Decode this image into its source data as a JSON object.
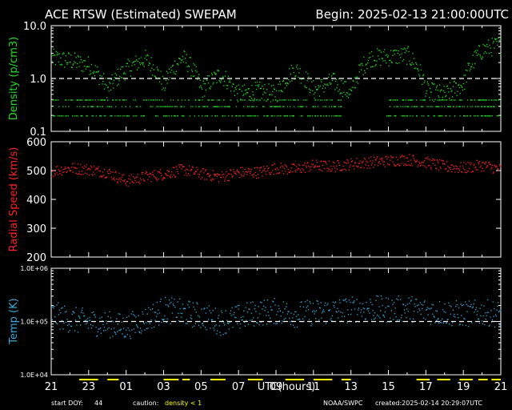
{
  "header": {
    "title": "ACE RTSW (Estimated) SWEPAM",
    "begin": "Begin: 2025-02-13 21:00:00UTC"
  },
  "footer": {
    "start_doy_label": "start DOY:",
    "start_doy_value": "44",
    "caution_label": "caution:",
    "caution_text": "density < 1",
    "source": "NOAA/SWPC",
    "created": "created:2025-02-14 20:29:07UTC"
  },
  "colors": {
    "density": "#22dd22",
    "speed": "#ff2222",
    "temp": "#33aadd",
    "caution": "#ffff00",
    "axes": "#ffffff"
  },
  "chart_data": [
    {
      "type": "scatter",
      "name": "density-panel",
      "ylabel": "Density (p/cm3)",
      "yscale": "log",
      "ylim": [
        0.1,
        10
      ],
      "ytick_labels": [
        "10.0",
        "1.0",
        "0.1"
      ],
      "ytick_values": [
        10,
        1,
        0.1
      ],
      "reference_line": 1.0,
      "x_range_hours": [
        0,
        24
      ],
      "series": [
        {
          "x": [
            0,
            1,
            2,
            3,
            4,
            5,
            6,
            7,
            8,
            9,
            10,
            11,
            12,
            13,
            14,
            15,
            16,
            17,
            18,
            19,
            20,
            21,
            22,
            23,
            24
          ],
          "values": [
            2.5,
            2.2,
            1.8,
            0.6,
            1.5,
            2.4,
            0.7,
            2.5,
            0.6,
            1.2,
            0.5,
            0.6,
            0.5,
            1.5,
            0.6,
            0.9,
            0.5,
            2.5,
            2.6,
            2.8,
            0.6,
            0.5,
            0.8,
            3.5,
            4.5
          ]
        }
      ]
    },
    {
      "type": "scatter",
      "name": "speed-panel",
      "ylabel": "Radial Speed (km/s)",
      "ylim": [
        200,
        600
      ],
      "ytick_labels": [
        "600",
        "500",
        "400",
        "300",
        "200"
      ],
      "ytick_values": [
        600,
        500,
        400,
        300,
        200
      ],
      "x_range_hours": [
        0,
        24
      ],
      "series": [
        {
          "x": [
            0,
            1,
            2,
            3,
            4,
            5,
            6,
            7,
            8,
            9,
            10,
            11,
            12,
            13,
            14,
            15,
            16,
            17,
            18,
            19,
            20,
            21,
            22,
            23,
            24
          ],
          "values": [
            500,
            510,
            505,
            495,
            465,
            480,
            490,
            505,
            490,
            480,
            495,
            495,
            510,
            505,
            520,
            515,
            525,
            530,
            535,
            540,
            530,
            515,
            510,
            520,
            505
          ]
        }
      ]
    },
    {
      "type": "scatter",
      "name": "temp-panel",
      "ylabel": "Temp (K)",
      "yscale": "log",
      "ylim": [
        10000,
        1000000
      ],
      "ytick_labels": [
        "1.0E+06",
        "1.0E+05",
        "1.0E+04"
      ],
      "ytick_values": [
        1000000,
        100000,
        10000
      ],
      "reference_line": 100000,
      "x_range_hours": [
        0,
        24
      ],
      "series": [
        {
          "x": [
            0,
            1,
            2,
            3,
            4,
            5,
            6,
            7,
            8,
            9,
            10,
            11,
            12,
            13,
            14,
            15,
            16,
            17,
            18,
            19,
            20,
            21,
            22,
            23,
            24
          ],
          "values": [
            140000,
            110000,
            100000,
            90000,
            80000,
            110000,
            170000,
            150000,
            130000,
            100000,
            120000,
            150000,
            160000,
            140000,
            150000,
            160000,
            170000,
            180000,
            170000,
            180000,
            160000,
            150000,
            140000,
            150000,
            140000
          ]
        }
      ]
    }
  ],
  "x_axis": {
    "label": "UTC(hours)",
    "tick_labels": [
      "21",
      "23",
      "01",
      "03",
      "05",
      "07",
      "09",
      "11",
      "13",
      "15",
      "17",
      "19",
      "21"
    ],
    "tick_values": [
      0,
      2,
      4,
      6,
      8,
      10,
      12,
      14,
      16,
      18,
      20,
      22,
      24
    ]
  },
  "caution_bars": [
    [
      1.5,
      2.5
    ],
    [
      3.0,
      3.6
    ],
    [
      6.0,
      6.8
    ],
    [
      7.0,
      7.4
    ],
    [
      8.5,
      9.3
    ],
    [
      10.5,
      11.3
    ],
    [
      12.5,
      13.5
    ],
    [
      14.0,
      15.0
    ],
    [
      15.5,
      16.0
    ],
    [
      19.5,
      20.2
    ],
    [
      20.6,
      21.3
    ],
    [
      21.8,
      22.5
    ],
    [
      22.8,
      23.3
    ],
    [
      23.5,
      24.0
    ]
  ]
}
